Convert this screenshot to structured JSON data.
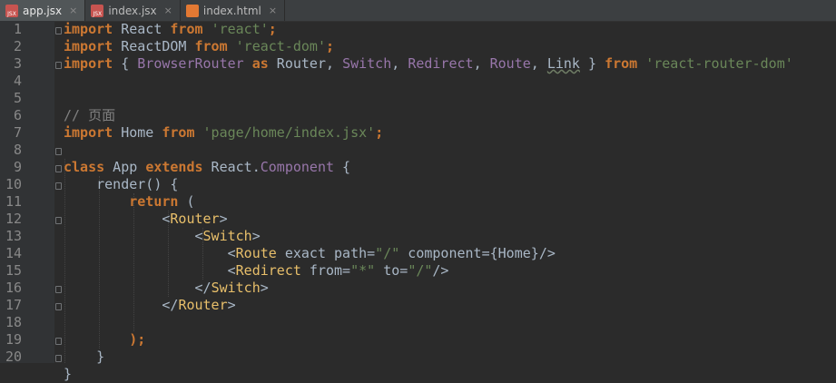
{
  "tabs": [
    {
      "label": "app.jsx",
      "icon": "jsx-file-icon",
      "active": true
    },
    {
      "label": "index.jsx",
      "icon": "jsx-file-icon",
      "active": false
    },
    {
      "label": "index.html",
      "icon": "html-file-icon",
      "active": false
    }
  ],
  "close_glyph": "×",
  "line_numbers": [
    "1",
    "2",
    "3",
    "4",
    "5",
    "6",
    "7",
    "8",
    "9",
    "10",
    "11",
    "12",
    "13",
    "14",
    "15",
    "16",
    "17",
    "18",
    "19",
    "20"
  ],
  "code": {
    "l1": {
      "kw1": "import",
      "t1": " React ",
      "kw2": "from",
      "t2": " ",
      "s1": "'react'",
      "t3": ";"
    },
    "l2": {
      "kw1": "import",
      "t1": " ReactDOM ",
      "kw2": "from",
      "t2": " ",
      "s1": "'react-dom'",
      "t3": ";"
    },
    "l3": {
      "kw1": "import",
      "t1": " { ",
      "i1": "BrowserRouter",
      "t2": " ",
      "kw2": "as",
      "t3": " Router, ",
      "i2": "Switch",
      "t4": ", ",
      "i3": "Redirect",
      "t5": ", ",
      "i4": "Route",
      "t6": ", ",
      "i5": "Link",
      "t7": " } ",
      "kw3": "from",
      "t8": " ",
      "s1": "'react-router-dom'"
    },
    "l5": {
      "c1": "// 页面"
    },
    "l6": {
      "kw1": "import",
      "t1": " Home ",
      "kw2": "from",
      "t2": " ",
      "s1": "'page/home/index.jsx'",
      "t3": ";"
    },
    "l8": {
      "kw1": "class",
      "t1": " App ",
      "kw2": "extends",
      "t2": " React.",
      "i1": "Component",
      "t3": " {"
    },
    "l9": {
      "t1": "    render() {"
    },
    "l10": {
      "t0": "        ",
      "kw1": "return",
      "t1": " ("
    },
    "l11": {
      "t0": "            ",
      "g1": "<",
      "tag1": "Router",
      "g2": ">"
    },
    "l12": {
      "t0": "                ",
      "g1": "<",
      "tag1": "Switch",
      "g2": ">"
    },
    "l13": {
      "t0": "                    ",
      "g1": "<",
      "tag1": "Route",
      "t1": " exact path=",
      "s1": "\"/\"",
      "t2": " component=",
      "t3": "{Home}",
      "g2": "/>"
    },
    "l14": {
      "t0": "                    ",
      "g1": "<",
      "tag1": "Redirect",
      "t1": " from=",
      "s1": "\"*\"",
      "t2": " to=",
      "s2": "\"/\"",
      "g2": "/>"
    },
    "l15": {
      "t0": "                ",
      "g1": "</",
      "tag1": "Switch",
      "g2": ">"
    },
    "l16": {
      "t0": "            ",
      "g1": "</",
      "tag1": "Router",
      "g2": ">"
    },
    "l18": {
      "t0": "        ",
      "t1": ");"
    },
    "l19": {
      "t0": "    ",
      "t1": "}"
    },
    "l20": {
      "t1": "}"
    }
  }
}
